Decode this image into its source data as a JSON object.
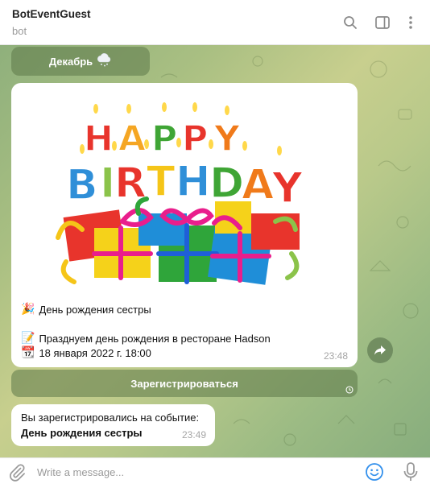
{
  "header": {
    "title": "BotEventGuest",
    "status": "bot"
  },
  "chat": {
    "month_button": {
      "label": "Декабрь",
      "icon": "cloud-snow-icon"
    },
    "event_message": {
      "image_text_top": "HAPPY",
      "image_text_bottom": "BIRTHDAY",
      "line1": {
        "icon": "party-popper-icon",
        "text": "День рождения сестры"
      },
      "line2": {
        "icon": "memo-icon",
        "text": "Празднуем день рождения в ресторане Hadson"
      },
      "line3": {
        "icon": "calendar-icon",
        "text": "18 января 2022 г. 18:00"
      },
      "time": "23:48"
    },
    "register_button": {
      "label": "Зарегистрироваться"
    },
    "reply_message": {
      "line1": "Вы зарегистрировались на событие:",
      "line2": "День рождения сестры",
      "time": "23:49"
    }
  },
  "input": {
    "placeholder": "Write a message..."
  },
  "colors": {
    "accent": "#3390ec",
    "button_bg": "#5c7848",
    "chat_bg": "#a9bf82"
  }
}
